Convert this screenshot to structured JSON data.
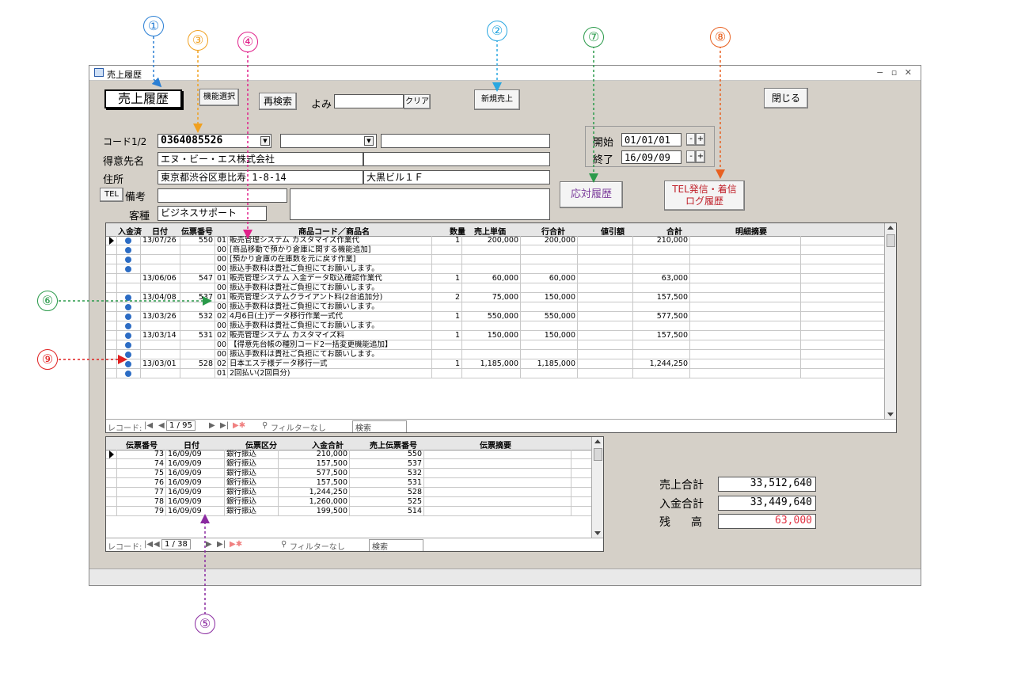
{
  "window": {
    "title": "売上履歴",
    "controls": "− ▫ ✕"
  },
  "header": {
    "form_title": "売上履歴",
    "func_select": "機能選択",
    "research": "再検索",
    "yomi_label": "よみ",
    "yomi_value": "",
    "clear": "クリア",
    "new_sale": "新規売上",
    "close": "閉じる"
  },
  "customer": {
    "code_label": "コード1/2",
    "code1": "0364085526",
    "code2": "",
    "code_extra": "",
    "name_label": "得意先名",
    "name": "エヌ・ビー・エス株式会社",
    "address_label": "住所",
    "address1": "東京都渋谷区恵比寿 1-8-14",
    "address2": "大黒ビル１Ｆ",
    "tel_button": "TEL",
    "note_label": "備考",
    "note": "",
    "category_label": "客種",
    "category": "ビジネスサポート"
  },
  "period": {
    "start_label": "開始",
    "start": "01/01/01",
    "end_label": "終了",
    "end": "16/09/09",
    "minus": "-",
    "plus": "+"
  },
  "buttons": {
    "contact_history": "応対履歴",
    "tel_log_line1": "TEL発信・着信",
    "tel_log_line2": "ログ履歴"
  },
  "sales_grid": {
    "headers": [
      "入金済",
      "日付",
      "伝票番号",
      "商品コード／商品名",
      "数量",
      "売上単価",
      "行合計",
      "値引額",
      "合計",
      "明細摘要"
    ],
    "rows": [
      {
        "paid": true,
        "date": "13/07/26",
        "slip": "550",
        "code": "01",
        "name": "販売管理システム カスタマイズ作業代",
        "qty": "1",
        "price": "200,000",
        "line": "200,000",
        "disc": "",
        "total": "210,000",
        "memo": "",
        "selected": true
      },
      {
        "paid": true,
        "date": "",
        "slip": "",
        "code": "00",
        "name": "[商品移動で預かり倉庫に関する機能追加]",
        "qty": "",
        "price": "",
        "line": "",
        "disc": "",
        "total": "",
        "memo": ""
      },
      {
        "paid": true,
        "date": "",
        "slip": "",
        "code": "00",
        "name": "[預かり倉庫の在庫数を元に戻す作業]",
        "qty": "",
        "price": "",
        "line": "",
        "disc": "",
        "total": "",
        "memo": ""
      },
      {
        "paid": true,
        "date": "",
        "slip": "",
        "code": "00",
        "name": "振込手数料は貴社ご負担にてお願いします。",
        "qty": "",
        "price": "",
        "line": "",
        "disc": "",
        "total": "",
        "memo": ""
      },
      {
        "paid": false,
        "date": "13/06/06",
        "slip": "547",
        "code": "01",
        "name": "販売管理システム 入金データ取込確認作業代",
        "qty": "1",
        "price": "60,000",
        "line": "60,000",
        "disc": "",
        "total": "63,000",
        "memo": ""
      },
      {
        "paid": false,
        "date": "",
        "slip": "",
        "code": "00",
        "name": "振込手数料は貴社ご負担にてお願いします。",
        "qty": "",
        "price": "",
        "line": "",
        "disc": "",
        "total": "",
        "memo": ""
      },
      {
        "paid": true,
        "date": "13/04/08",
        "slip": "537",
        "code": "01",
        "name": "販売管理システムクライアント料(2台追加分)",
        "qty": "2",
        "price": "75,000",
        "line": "150,000",
        "disc": "",
        "total": "157,500",
        "memo": ""
      },
      {
        "paid": true,
        "date": "",
        "slip": "",
        "code": "00",
        "name": "振込手数料は貴社ご負担にてお願いします。",
        "qty": "",
        "price": "",
        "line": "",
        "disc": "",
        "total": "",
        "memo": ""
      },
      {
        "paid": true,
        "date": "13/03/26",
        "slip": "532",
        "code": "02",
        "name": "4月6日(土)データ移行作業一式代",
        "qty": "1",
        "price": "550,000",
        "line": "550,000",
        "disc": "",
        "total": "577,500",
        "memo": ""
      },
      {
        "paid": true,
        "date": "",
        "slip": "",
        "code": "00",
        "name": "振込手数料は貴社ご負担にてお願いします。",
        "qty": "",
        "price": "",
        "line": "",
        "disc": "",
        "total": "",
        "memo": ""
      },
      {
        "paid": true,
        "date": "13/03/14",
        "slip": "531",
        "code": "02",
        "name": "販売管理システム カスタマイズ料",
        "qty": "1",
        "price": "150,000",
        "line": "150,000",
        "disc": "",
        "total": "157,500",
        "memo": ""
      },
      {
        "paid": true,
        "date": "",
        "slip": "",
        "code": "00",
        "name": "【得意先台帳の種別コード2一括変更機能追加】",
        "qty": "",
        "price": "",
        "line": "",
        "disc": "",
        "total": "",
        "memo": ""
      },
      {
        "paid": true,
        "date": "",
        "slip": "",
        "code": "00",
        "name": "振込手数料は貴社ご負担にてお願いします。",
        "qty": "",
        "price": "",
        "line": "",
        "disc": "",
        "total": "",
        "memo": ""
      },
      {
        "paid": true,
        "date": "13/03/01",
        "slip": "528",
        "code": "02",
        "name": "日本エステ様データ移行一式",
        "qty": "1",
        "price": "1,185,000",
        "line": "1,185,000",
        "disc": "",
        "total": "1,244,250",
        "memo": ""
      },
      {
        "paid": true,
        "date": "",
        "slip": "",
        "code": "01",
        "name": "2回払い(2回目分)",
        "qty": "",
        "price": "",
        "line": "",
        "disc": "",
        "total": "",
        "memo": ""
      }
    ],
    "nav": {
      "label": "レコード: ",
      "first": "◀",
      "prev": "◀",
      "position": "1 / 95",
      "next": "▶",
      "last": "▶|",
      "new": "▶✱",
      "filter": "フィルターなし",
      "search": "検索"
    }
  },
  "payment_grid": {
    "headers": [
      "伝票番号",
      "日付",
      "伝票区分",
      "入金合計",
      "売上伝票番号",
      "伝票摘要"
    ],
    "rows": [
      {
        "slip": "73",
        "date": "16/09/09",
        "kind": "銀行振込",
        "amount": "210,000",
        "sale_slip": "550",
        "memo": "",
        "selected": true
      },
      {
        "slip": "74",
        "date": "16/09/09",
        "kind": "銀行振込",
        "amount": "157,500",
        "sale_slip": "537",
        "memo": ""
      },
      {
        "slip": "75",
        "date": "16/09/09",
        "kind": "銀行振込",
        "amount": "577,500",
        "sale_slip": "532",
        "memo": ""
      },
      {
        "slip": "76",
        "date": "16/09/09",
        "kind": "銀行振込",
        "amount": "157,500",
        "sale_slip": "531",
        "memo": ""
      },
      {
        "slip": "77",
        "date": "16/09/09",
        "kind": "銀行振込",
        "amount": "1,244,250",
        "sale_slip": "528",
        "memo": ""
      },
      {
        "slip": "78",
        "date": "16/09/09",
        "kind": "銀行振込",
        "amount": "1,260,000",
        "sale_slip": "525",
        "memo": ""
      },
      {
        "slip": "79",
        "date": "16/09/09",
        "kind": "銀行振込",
        "amount": "199,500",
        "sale_slip": "514",
        "memo": ""
      }
    ],
    "nav": {
      "label": "レコード: ",
      "position": "1 / 38",
      "filter": "フィルターなし",
      "search": "検索"
    }
  },
  "totals": {
    "sales_label": "売上合計",
    "sales": "33,512,640",
    "paid_label": "入金合計",
    "paid": "33,449,640",
    "balance_label": "残　高",
    "balance": "63,000",
    "balance_color": "#e03040"
  },
  "callouts": [
    {
      "n": "①",
      "color": "#2a7fd4"
    },
    {
      "n": "②",
      "color": "#2aa7e0"
    },
    {
      "n": "③",
      "color": "#f0a020"
    },
    {
      "n": "④",
      "color": "#e0208a"
    },
    {
      "n": "⑤",
      "color": "#8a2aa0"
    },
    {
      "n": "⑥",
      "color": "#2a9a4a"
    },
    {
      "n": "⑦",
      "color": "#2a9a4a"
    },
    {
      "n": "⑧",
      "color": "#e86020"
    },
    {
      "n": "⑨",
      "color": "#e02020"
    }
  ]
}
